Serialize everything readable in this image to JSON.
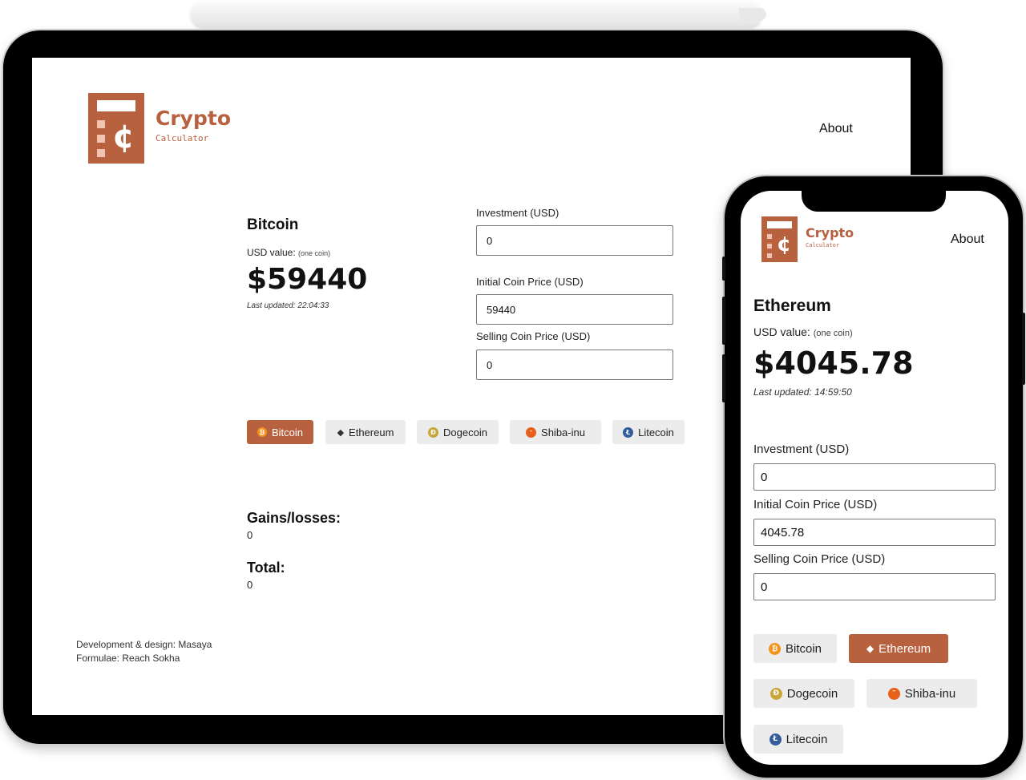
{
  "brand": {
    "name": "Crypto",
    "tagline": "Calculator",
    "color": "#b8613f"
  },
  "nav": {
    "about": "About"
  },
  "tablet": {
    "coin": {
      "name": "Bitcoin",
      "usd_label": "USD value:",
      "usd_note": "(one coin)",
      "price": "$59440",
      "updated_label": "Last updated:",
      "updated_time": "22:04:33"
    },
    "fields": {
      "investment": {
        "label": "Investment (USD)",
        "value": "0"
      },
      "initial": {
        "label": "Initial Coin Price (USD)",
        "value": "59440"
      },
      "selling": {
        "label": "Selling Coin Price (USD)",
        "value": "0"
      }
    },
    "coins": [
      {
        "label": "Bitcoin",
        "icon": "bitcoin-icon",
        "active": true
      },
      {
        "label": "Ethereum",
        "icon": "ethereum-icon",
        "active": false
      },
      {
        "label": "Dogecoin",
        "icon": "dogecoin-icon",
        "active": false
      },
      {
        "label": "Shiba-inu",
        "icon": "shiba-inu-icon",
        "active": false
      },
      {
        "label": "Litecoin",
        "icon": "litecoin-icon",
        "active": false
      }
    ],
    "results": {
      "gains_label": "Gains/losses:",
      "gains_value": "0",
      "total_label": "Total:",
      "total_value": "0"
    },
    "credits": {
      "line1": "Development & design: Masaya",
      "line2": "Formulae: Reach Sokha"
    }
  },
  "phone": {
    "coin": {
      "name": "Ethereum",
      "usd_label": "USD value:",
      "usd_note": "(one coin)",
      "price": "$4045.78",
      "updated_label": "Last updated:",
      "updated_time": "14:59:50"
    },
    "fields": {
      "investment": {
        "label": "Investment (USD)",
        "value": "0"
      },
      "initial": {
        "label": "Initial Coin Price (USD)",
        "value": "4045.78"
      },
      "selling": {
        "label": "Selling Coin Price (USD)",
        "value": "0"
      }
    },
    "coins": [
      {
        "label": "Bitcoin",
        "icon": "bitcoin-icon",
        "active": false
      },
      {
        "label": "Ethereum",
        "icon": "ethereum-icon",
        "active": true
      },
      {
        "label": "Dogecoin",
        "icon": "dogecoin-icon",
        "active": false
      },
      {
        "label": "Shiba-inu",
        "icon": "shiba-inu-icon",
        "active": false
      },
      {
        "label": "Litecoin",
        "icon": "litecoin-icon",
        "active": false
      }
    ]
  }
}
